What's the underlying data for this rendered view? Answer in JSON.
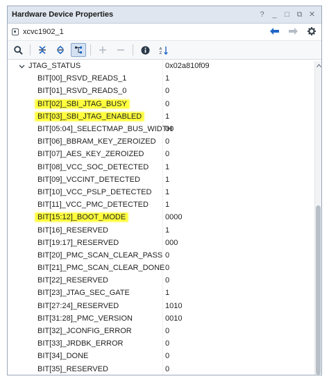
{
  "window": {
    "title": "Hardware Device Properties",
    "controls": [
      "?",
      "_",
      "□",
      "⧉",
      "✕"
    ]
  },
  "device": {
    "name": "xcvc1902_1"
  },
  "toolbar": {
    "icons": [
      "search-icon",
      "collapse-all-icon",
      "expand-all-icon",
      "tree-view-icon",
      "add-icon",
      "remove-icon",
      "info-icon",
      "sort-icon"
    ]
  },
  "table": {
    "group": {
      "name": "JTAG_STATUS",
      "value": "0x02a810f09"
    },
    "rows": [
      {
        "name": "BIT[00]_RSVD_READS_1",
        "value": "1"
      },
      {
        "name": "BIT[01]_RSVD_READS_0",
        "value": "0"
      },
      {
        "name": "BIT[02]_SBI_JTAG_BUSY",
        "value": "0",
        "highlight": true
      },
      {
        "name": "BIT[03]_SBI_JTAG_ENABLED",
        "value": "1",
        "highlight": true
      },
      {
        "name": "BIT[05:04]_SELECTMAP_BUS_WIDTH",
        "value": "00"
      },
      {
        "name": "BIT[06]_BBRAM_KEY_ZEROIZED",
        "value": "0"
      },
      {
        "name": "BIT[07]_AES_KEY_ZEROIZED",
        "value": "0"
      },
      {
        "name": "BIT[08]_VCC_SOC_DETECTED",
        "value": "1"
      },
      {
        "name": "BIT[09]_VCCINT_DETECTED",
        "value": "1"
      },
      {
        "name": "BIT[10]_VCC_PSLP_DETECTED",
        "value": "1"
      },
      {
        "name": "BIT[11]_VCC_PMC_DETECTED",
        "value": "1"
      },
      {
        "name": "BIT[15:12]_BOOT_MODE",
        "value": "0000",
        "highlight": true
      },
      {
        "name": "BIT[16]_RESERVED",
        "value": "1"
      },
      {
        "name": "BIT[19:17]_RESERVED",
        "value": "000"
      },
      {
        "name": "BIT[20]_PMC_SCAN_CLEAR_PASS",
        "value": "0"
      },
      {
        "name": "BIT[21]_PMC_SCAN_CLEAR_DONE",
        "value": "0"
      },
      {
        "name": "BIT[22]_RESERVED",
        "value": "0"
      },
      {
        "name": "BIT[23]_JTAG_SEC_GATE",
        "value": "1"
      },
      {
        "name": "BIT[27:24]_RESERVED",
        "value": "1010"
      },
      {
        "name": "BIT[31:28]_PMC_VERSION",
        "value": "0010"
      },
      {
        "name": "BIT[32]_JCONFIG_ERROR",
        "value": "0"
      },
      {
        "name": "BIT[33]_JRDBK_ERROR",
        "value": "0"
      },
      {
        "name": "BIT[34]_DONE",
        "value": "0"
      },
      {
        "name": "BIT[35]_RESERVED",
        "value": "0"
      }
    ]
  },
  "colors": {
    "highlight": "#ffff3d",
    "accent": "#1f66c5",
    "titlebar": "#dfe6ef"
  }
}
